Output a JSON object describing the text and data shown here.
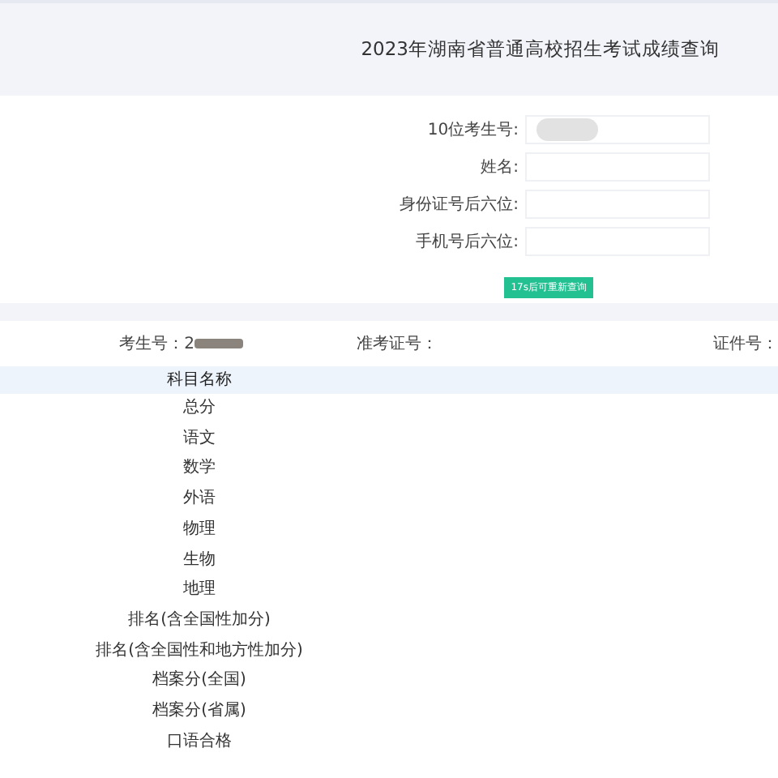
{
  "header": {
    "title": "2023年湖南省普通高校招生考试成绩查询"
  },
  "form": {
    "fields": [
      {
        "label": "10位考生号:",
        "redacted": true
      },
      {
        "label": "姓名:",
        "redacted": false
      },
      {
        "label": "身份证号后六位:",
        "redacted": false
      },
      {
        "label": "手机号后六位:",
        "redacted": false
      }
    ],
    "button": {
      "label": "17s后可重新查询",
      "disabled": true
    }
  },
  "info": [
    {
      "label": "考生号：",
      "value": "2",
      "redacted": true
    },
    {
      "label": "准考证号："
    },
    {
      "label": "证件号："
    }
  ],
  "table": {
    "columns": [
      "科目名称"
    ],
    "rows": [
      "总分",
      "语文",
      "数学",
      "外语",
      "物理",
      "生物",
      "地理",
      "排名(含全国性加分)",
      "排名(含全国性和地方性加分)",
      "档案分(全国)",
      "档案分(省属)",
      "口语合格"
    ]
  }
}
